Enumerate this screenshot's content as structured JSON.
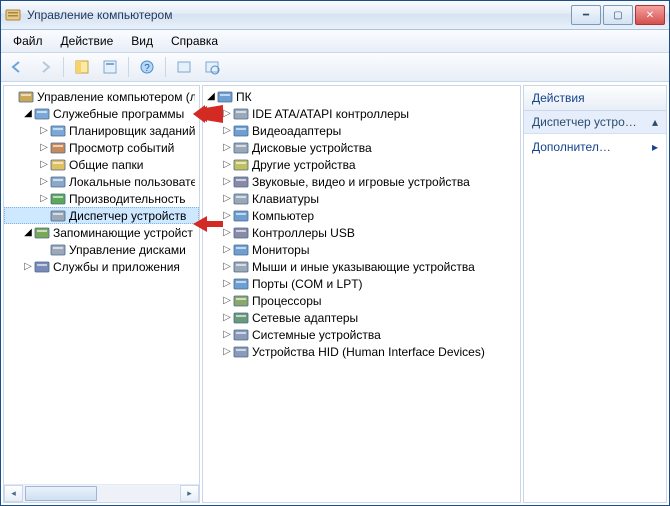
{
  "titlebar": {
    "title": "Управление компьютером"
  },
  "menubar": [
    "Файл",
    "Действие",
    "Вид",
    "Справка"
  ],
  "actions": {
    "header": "Действия",
    "context": "Диспетчер устро…",
    "more": "Дополнител…"
  },
  "left_tree": [
    {
      "depth": 0,
      "twist": "",
      "icon": "mmc",
      "label": "Управление компьютером (л",
      "sel": false
    },
    {
      "depth": 1,
      "twist": "open",
      "icon": "tools",
      "label": "Служебные программы",
      "sel": false
    },
    {
      "depth": 2,
      "twist": "closed",
      "icon": "sched",
      "label": "Планировщик заданий",
      "sel": false
    },
    {
      "depth": 2,
      "twist": "closed",
      "icon": "event",
      "label": "Просмотр событий",
      "sel": false
    },
    {
      "depth": 2,
      "twist": "closed",
      "icon": "share",
      "label": "Общие папки",
      "sel": false
    },
    {
      "depth": 2,
      "twist": "closed",
      "icon": "users",
      "label": "Локальные пользовател",
      "sel": false
    },
    {
      "depth": 2,
      "twist": "closed",
      "icon": "perf",
      "label": "Производительность",
      "sel": false
    },
    {
      "depth": 2,
      "twist": "",
      "icon": "devmgr",
      "label": "Диспетчер устройств",
      "sel": true
    },
    {
      "depth": 1,
      "twist": "open",
      "icon": "storage",
      "label": "Запоминающие устройст",
      "sel": false
    },
    {
      "depth": 2,
      "twist": "",
      "icon": "diskmgr",
      "label": "Управление дисками",
      "sel": false
    },
    {
      "depth": 1,
      "twist": "closed",
      "icon": "services",
      "label": "Службы и приложения",
      "sel": false
    }
  ],
  "mid_tree": [
    {
      "depth": 0,
      "twist": "open",
      "icon": "computer",
      "label": "ПК"
    },
    {
      "depth": 1,
      "twist": "closed",
      "icon": "ide",
      "label": "IDE ATA/ATAPI контроллеры"
    },
    {
      "depth": 1,
      "twist": "closed",
      "icon": "display",
      "label": "Видеоадаптеры"
    },
    {
      "depth": 1,
      "twist": "closed",
      "icon": "disk",
      "label": "Дисковые устройства"
    },
    {
      "depth": 1,
      "twist": "closed",
      "icon": "other",
      "label": "Другие устройства"
    },
    {
      "depth": 1,
      "twist": "closed",
      "icon": "sound",
      "label": "Звуковые, видео и игровые устройства"
    },
    {
      "depth": 1,
      "twist": "closed",
      "icon": "keyboard",
      "label": "Клавиатуры"
    },
    {
      "depth": 1,
      "twist": "closed",
      "icon": "computer",
      "label": "Компьютер"
    },
    {
      "depth": 1,
      "twist": "closed",
      "icon": "usb",
      "label": "Контроллеры USB"
    },
    {
      "depth": 1,
      "twist": "closed",
      "icon": "monitor",
      "label": "Мониторы"
    },
    {
      "depth": 1,
      "twist": "closed",
      "icon": "mouse",
      "label": "Мыши и иные указывающие устройства"
    },
    {
      "depth": 1,
      "twist": "closed",
      "icon": "port",
      "label": "Порты (COM и LPT)"
    },
    {
      "depth": 1,
      "twist": "closed",
      "icon": "cpu",
      "label": "Процессоры"
    },
    {
      "depth": 1,
      "twist": "closed",
      "icon": "net",
      "label": "Сетевые адаптеры"
    },
    {
      "depth": 1,
      "twist": "closed",
      "icon": "system",
      "label": "Системные устройства"
    },
    {
      "depth": 1,
      "twist": "closed",
      "icon": "hid",
      "label": "Устройства HID (Human Interface Devices)"
    }
  ],
  "icons": {
    "mmc": "#c9a85a",
    "tools": "#7aa8d8",
    "sched": "#7aa8d8",
    "event": "#c98a5a",
    "share": "#e0c060",
    "users": "#8aa8c8",
    "perf": "#5aa85a",
    "devmgr": "#9aa8b8",
    "storage": "#7aa85a",
    "diskmgr": "#9aa8b8",
    "services": "#7a8ab8",
    "computer": "#6d9fd2",
    "ide": "#9aa8b8",
    "display": "#6d9fd2",
    "disk": "#9aa8b8",
    "other": "#c0c060",
    "sound": "#8a8aa8",
    "keyboard": "#9aa8b8",
    "usb": "#8a8aa8",
    "monitor": "#6d9fd2",
    "mouse": "#9aa8b8",
    "port": "#6d9fd2",
    "cpu": "#8aa86a",
    "net": "#6a9a7a",
    "system": "#8a9ab8",
    "hid": "#8a9ab8"
  }
}
